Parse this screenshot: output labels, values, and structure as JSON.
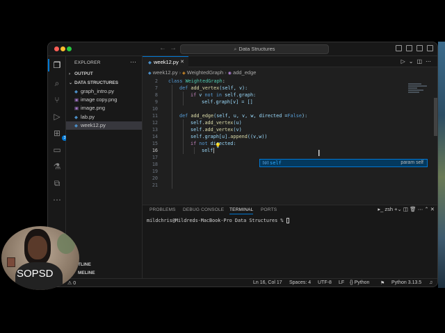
{
  "window": {
    "command_center": "Data Structures"
  },
  "sidebar": {
    "title": "EXPLORER",
    "sections": {
      "output": "OUTPUT",
      "folder": "DATA STRUCTURES"
    },
    "files": [
      {
        "name": "graph_intro.py",
        "type": "python",
        "selected": false
      },
      {
        "name": "image copy.png",
        "type": "image",
        "selected": false
      },
      {
        "name": "image.png",
        "type": "image",
        "selected": false
      },
      {
        "name": "lab.py",
        "type": "python",
        "selected": false
      },
      {
        "name": "week12.py",
        "type": "python",
        "selected": true
      }
    ],
    "outline_label": "TLINE",
    "timeline_label": "MELINE"
  },
  "activity_badge": "3",
  "editor": {
    "tab": "week12.py",
    "breadcrumb": {
      "file": "week12.py",
      "class": "WeightedGraph",
      "method": "add_edge"
    },
    "lines": {
      "l2": {
        "num": "2",
        "a": "class ",
        "b": "WeightedGraph",
        "c": ":"
      },
      "l7": {
        "num": "7",
        "a": "def ",
        "b": "add_vertex",
        "c": "(self, v):"
      },
      "l8": {
        "num": "8",
        "a": "if ",
        "b": "v ",
        "c": "not in ",
        "d": "self",
        "e": ".graph:"
      },
      "l9": {
        "num": "9",
        "a": "self",
        "b": ".graph[v] = []"
      },
      "l10": {
        "num": "10"
      },
      "l11": {
        "num": "11",
        "a": "def ",
        "b": "add_edge",
        "c": "(self, u, v, w, directed =",
        "d": "False",
        "e": "):"
      },
      "l12": {
        "num": "12",
        "a": "self",
        "b": ".",
        "c": "add_vertex",
        "d": "(u)"
      },
      "l13": {
        "num": "13",
        "a": "self",
        "b": ".",
        "c": "add_vertex",
        "d": "(v)"
      },
      "l14": {
        "num": "14",
        "a": "self",
        "b": ".graph[u].",
        "c": "append",
        "d": "((v,w))"
      },
      "l15": {
        "num": "15",
        "a": "if ",
        "b": "not ",
        "c": "directed:"
      },
      "l16": {
        "num": "16",
        "a": "self"
      },
      "l17": {
        "num": "17"
      },
      "l18": {
        "num": "18"
      },
      "l19": {
        "num": "19"
      },
      "l20": {
        "num": "20"
      },
      "l21": {
        "num": "21"
      }
    },
    "suggestion": {
      "icon": "[@]",
      "match": "self",
      "detail": "param self"
    }
  },
  "panel": {
    "tabs": [
      "PROBLEMS",
      "DEBUG CONSOLE",
      "TERMINAL",
      "PORTS"
    ],
    "active_tab": "TERMINAL",
    "shell": "zsh",
    "prompt": "mildchris@Mildreds-MacBook-Pro Data Structures %"
  },
  "statusbar": {
    "problems": "0",
    "position": "Ln 16, Col 17",
    "spaces": "Spaces: 4",
    "encoding": "UTF-8",
    "eol": "LF",
    "language": "Python",
    "interpreter": "Python 3.13.5"
  },
  "overlay": {
    "label": "SOPSD"
  }
}
